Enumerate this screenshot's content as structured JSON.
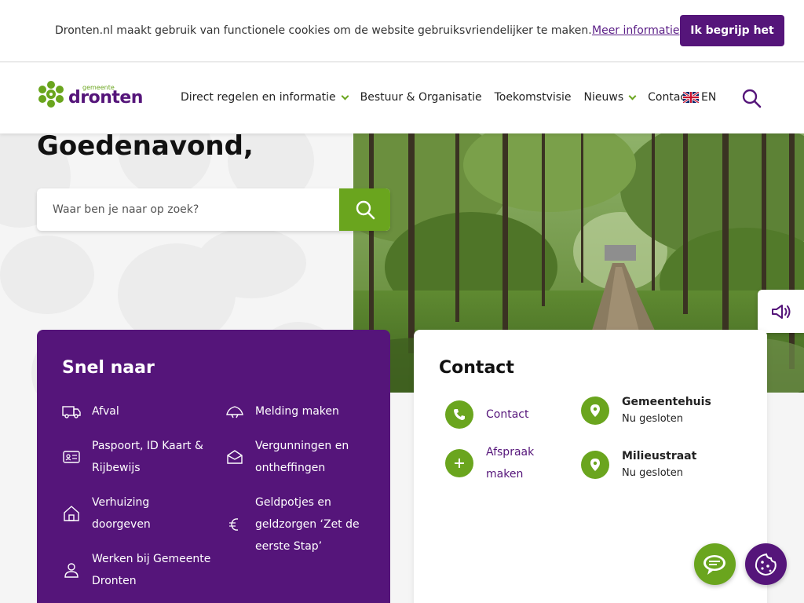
{
  "cookie_bar": {
    "message": "Dronten.nl maakt gebruik van functionele cookies om de website gebruiksvriendelijker te maken.",
    "more_info": "Meer informatie",
    "accept": "Ik begrijp het"
  },
  "header": {
    "logo_small": "gemeente",
    "logo_main": "dronten",
    "nav": [
      {
        "label": "Direct regelen en informatie",
        "dropdown": true
      },
      {
        "label": "Bestuur & Organisatie",
        "dropdown": false
      },
      {
        "label": "Toekomstvisie",
        "dropdown": false
      },
      {
        "label": "Nieuws",
        "dropdown": true
      },
      {
        "label": "Contact",
        "dropdown": false
      }
    ],
    "language": "EN"
  },
  "hero": {
    "greeting": "Goedenavond,",
    "search_placeholder": "Waar ben je naar op zoek?"
  },
  "snel_naar": {
    "title": "Snel naar",
    "items": [
      {
        "label": "Afval",
        "icon": "truck-icon"
      },
      {
        "label": "Melding maken",
        "icon": "megaphone-icon"
      },
      {
        "label": "Paspoort, ID Kaart & Rijbewijs",
        "icon": "id-card-icon"
      },
      {
        "label": "Vergunningen en ontheffingen",
        "icon": "envelope-open-icon"
      },
      {
        "label": "Verhuizing doorgeven",
        "icon": "house-icon"
      },
      {
        "label": "Geldpotjes en geldzorgen ‘Zet de eerste Stap’",
        "icon": "euro-icon"
      },
      {
        "label": "Werken bij Gemeente Dronten",
        "icon": "person-icon"
      }
    ]
  },
  "contact": {
    "title": "Contact",
    "links": [
      {
        "label": "Contact",
        "icon": "phone-icon"
      },
      {
        "label": "Afspraak maken",
        "icon": "plus-icon"
      }
    ],
    "locations": [
      {
        "name": "Gemeentehuis",
        "status": "Nu gesloten",
        "icon": "location-pin-icon"
      },
      {
        "name": "Milieustraat",
        "status": "Nu gesloten",
        "icon": "location-pin-icon"
      }
    ]
  },
  "colors": {
    "purple": "#55157a",
    "green": "#6aa51e"
  }
}
